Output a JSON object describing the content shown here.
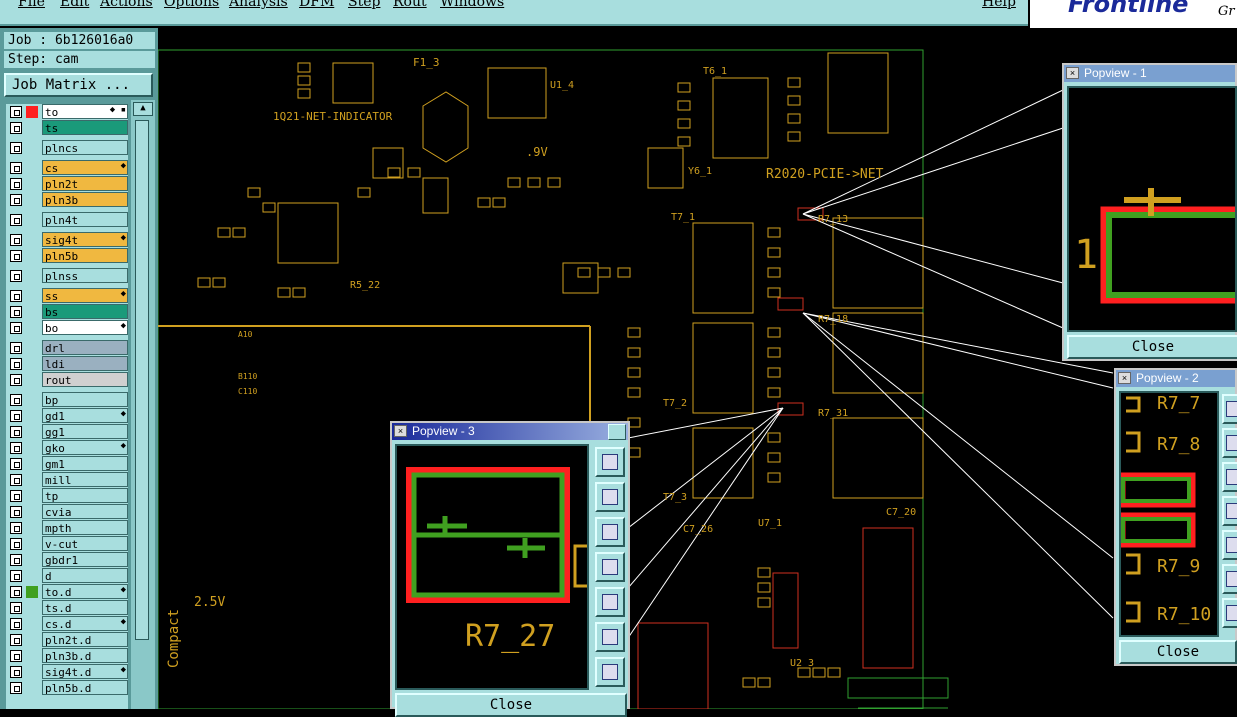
{
  "menu": {
    "items": [
      "File",
      "Edit",
      "Actions",
      "Options",
      "Analysis",
      "DFM",
      "Step",
      "Rout",
      "Windows"
    ],
    "help": "Help"
  },
  "brand": {
    "logo": "Frontline",
    "suffix": "Gr"
  },
  "job": {
    "label": "Job :  6b126016a0",
    "step": "Step: cam"
  },
  "job_matrix": "Job Matrix ...",
  "layers": [
    {
      "name": "to",
      "color": "#ffffff",
      "sel": "red",
      "arrow": "◆ ▪"
    },
    {
      "name": "ts",
      "color": "#1a9a7a",
      "sel": "",
      "arrow": ""
    },
    {
      "name": "plncs",
      "color": "#a8dede",
      "sel": "",
      "arrow": ""
    },
    {
      "name": "cs",
      "color": "#f0b840",
      "sel": "",
      "arrow": "◆"
    },
    {
      "name": "pln2t",
      "color": "#f0b840",
      "sel": "",
      "arrow": ""
    },
    {
      "name": "pln3b",
      "color": "#f0b840",
      "sel": "",
      "arrow": ""
    },
    {
      "name": "pln4t",
      "color": "#a8dede",
      "sel": "",
      "arrow": ""
    },
    {
      "name": "sig4t",
      "color": "#f0b840",
      "sel": "",
      "arrow": "◆"
    },
    {
      "name": "pln5b",
      "color": "#f0b840",
      "sel": "",
      "arrow": ""
    },
    {
      "name": "plnss",
      "color": "#a8dede",
      "sel": "",
      "arrow": ""
    },
    {
      "name": "ss",
      "color": "#f0b840",
      "sel": "",
      "arrow": "◆"
    },
    {
      "name": "bs",
      "color": "#1a9a7a",
      "sel": "",
      "arrow": ""
    },
    {
      "name": "bo",
      "color": "#ffffff",
      "sel": "",
      "arrow": "◆"
    },
    {
      "name": "drl",
      "color": "#9ab0c0",
      "sel": "",
      "arrow": ""
    },
    {
      "name": "ldi",
      "color": "#9ab0c0",
      "sel": "",
      "arrow": ""
    },
    {
      "name": "rout",
      "color": "#d0d0d0",
      "sel": "",
      "arrow": ""
    },
    {
      "name": "bp",
      "color": "#a8dede",
      "sel": "",
      "arrow": ""
    },
    {
      "name": "gd1",
      "color": "#a8dede",
      "sel": "",
      "arrow": "◆"
    },
    {
      "name": "gg1",
      "color": "#a8dede",
      "sel": "",
      "arrow": ""
    },
    {
      "name": "gko",
      "color": "#a8dede",
      "sel": "",
      "arrow": "◆"
    },
    {
      "name": "gm1",
      "color": "#a8dede",
      "sel": "",
      "arrow": ""
    },
    {
      "name": "mill",
      "color": "#a8dede",
      "sel": "",
      "arrow": ""
    },
    {
      "name": "tp",
      "color": "#a8dede",
      "sel": "",
      "arrow": ""
    },
    {
      "name": "cvia",
      "color": "#a8dede",
      "sel": "",
      "arrow": ""
    },
    {
      "name": "mpth",
      "color": "#a8dede",
      "sel": "",
      "arrow": ""
    },
    {
      "name": "v-cut",
      "color": "#a8dede",
      "sel": "",
      "arrow": ""
    },
    {
      "name": "gbdr1",
      "color": "#a8dede",
      "sel": "",
      "arrow": ""
    },
    {
      "name": "d",
      "color": "#a8dede",
      "sel": "",
      "arrow": ""
    },
    {
      "name": "to.d",
      "color": "#a8dede",
      "sel": "green",
      "arrow": "◆"
    },
    {
      "name": "ts.d",
      "color": "#a8dede",
      "sel": "",
      "arrow": ""
    },
    {
      "name": "cs.d",
      "color": "#a8dede",
      "sel": "",
      "arrow": "◆"
    },
    {
      "name": "pln2t.d",
      "color": "#a8dede",
      "sel": "",
      "arrow": ""
    },
    {
      "name": "pln3b.d",
      "color": "#a8dede",
      "sel": "",
      "arrow": ""
    },
    {
      "name": "sig4t.d",
      "color": "#a8dede",
      "sel": "",
      "arrow": "◆"
    },
    {
      "name": "pln5b.d",
      "color": "#a8dede",
      "sel": "",
      "arrow": ""
    }
  ],
  "board_labels": {
    "net1": "1Q21-NET-INDICATOR",
    "net2": "R2020-PCIE->NET",
    "f1": "F1_3",
    "u1": "U1_4",
    "t6": "T6_1",
    "t7": "T7_1",
    "t72": "T7_2",
    "t73": "T7_3",
    "r713": "R7_13",
    "r718": "R7_18",
    "r531": "R7_31",
    "compact": "Compact",
    "v25": "2.5V",
    "v19": ".9V",
    "y6": "Y6_1",
    "r522": "R5_22",
    "u23": "U2_3",
    "u71": "U7_1",
    "c726": "C7_26",
    "c720": "C7_20",
    "a10": "A10",
    "b110": "B110",
    "c110": "C110"
  },
  "popups": [
    {
      "title": "Popview - 1",
      "close": "Close",
      "label": "1"
    },
    {
      "title": "Popview - 2",
      "close": "Close",
      "labels": [
        "R7_7",
        "R7_8",
        "R7_9",
        "R7_10"
      ]
    },
    {
      "title": "Popview - 3",
      "close": "Close",
      "label": "R7_27"
    }
  ],
  "colors": {
    "panel": "#a8dede",
    "trace_yellow": "#d0a020",
    "trace_red": "#ff2020",
    "trace_green": "#40a020",
    "canvas": "#000000"
  }
}
